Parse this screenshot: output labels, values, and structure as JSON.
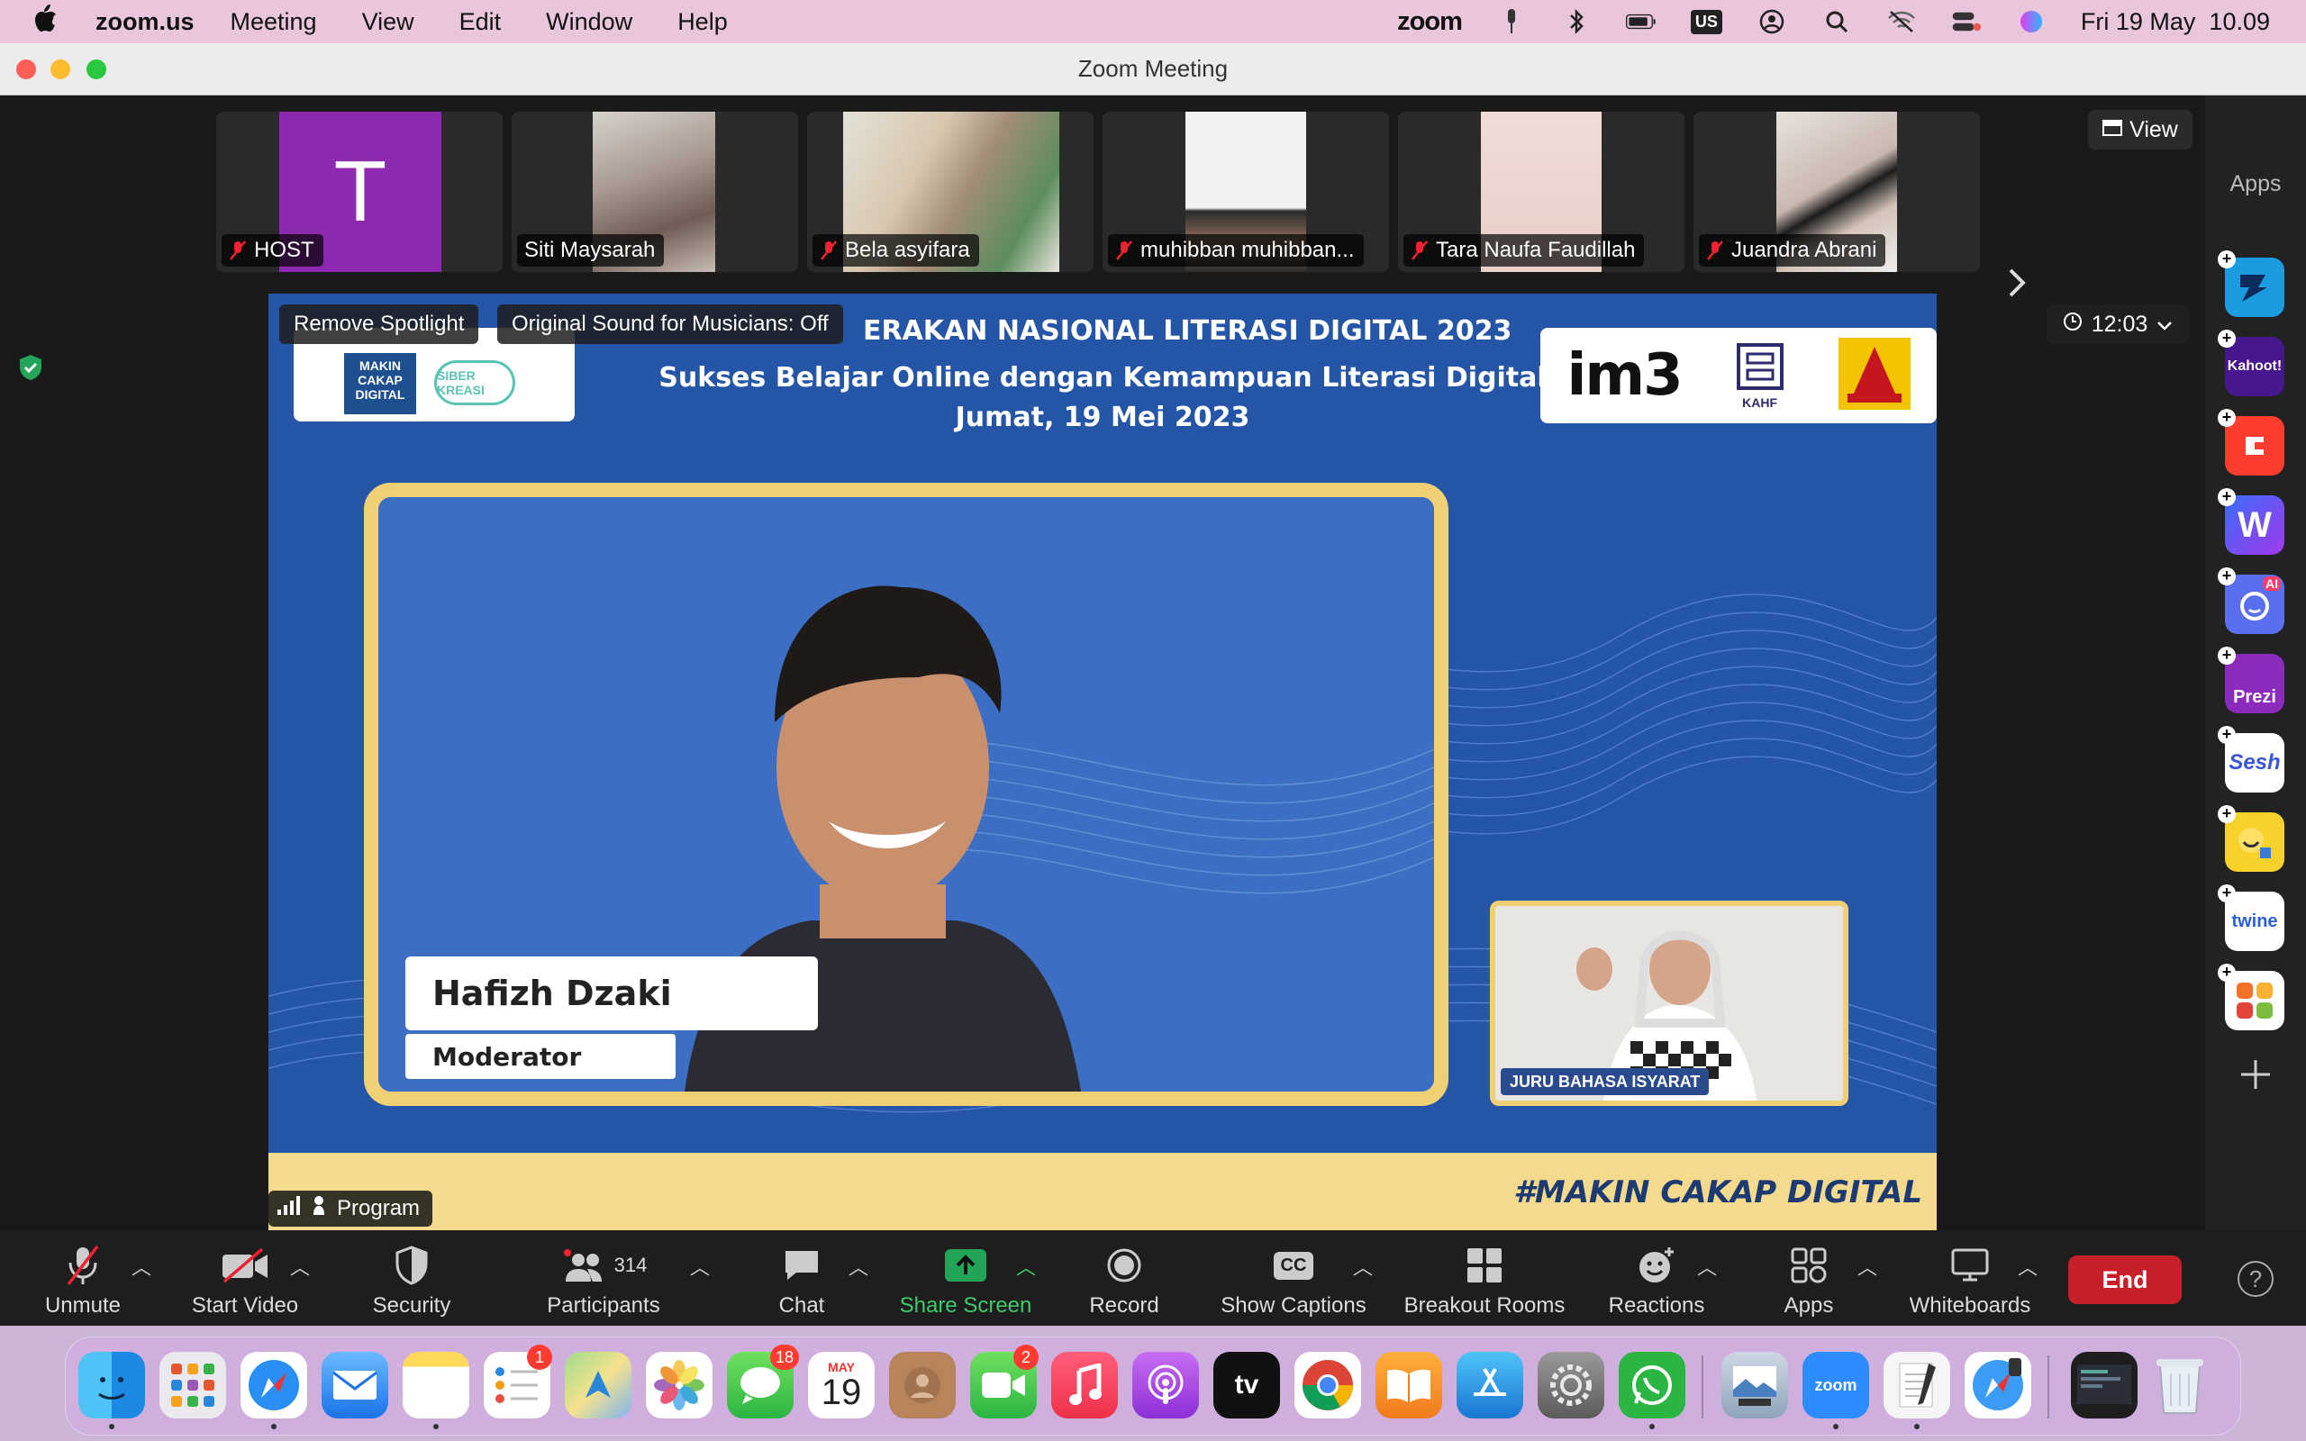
{
  "menubar": {
    "app_name": "zoom.us",
    "items": [
      "Meeting",
      "View",
      "Edit",
      "Window",
      "Help"
    ],
    "zoom_label": "zoom",
    "keyboard": "US",
    "datetime": "Fri 19 May  10.09"
  },
  "window": {
    "title": "Zoom Meeting"
  },
  "thumbnails": [
    {
      "name": "HOST",
      "initial": "T",
      "avatar_color": "#8e2ab0"
    },
    {
      "name": "Siti Maysarah"
    },
    {
      "name": "Bela asyifara"
    },
    {
      "name": "muhibban muhibban..."
    },
    {
      "name": "Tara Naufa Faudillah"
    },
    {
      "name": "Juandra Abrani"
    }
  ],
  "view_button": "View",
  "overlay": {
    "remove_spotlight": "Remove Spotlight",
    "original_sound": "Original Sound for Musicians: Off",
    "program": "Program",
    "timer": "12:03"
  },
  "slide": {
    "title1": "ERAKAN NASIONAL LITERASI DIGITAL 2023",
    "title2": "Sukses Belajar Online dengan Kemampuan Literasi Digital",
    "title3": "Jumat, 19 Mei 2023",
    "sponsor": "im3",
    "sponsor2": "KAHF",
    "speaker_name": "Hafizh Dzaki",
    "speaker_role": "Moderator",
    "interpreter_label": "JURU BAHASA ISYARAT",
    "hashtag": "#MAKIN CAKAP DIGITAL",
    "logo_left": "MAKIN CAKAP DIGITAL",
    "logo_left2": "SIBER KREASI"
  },
  "apps_panel": {
    "title": "Apps",
    "apps": [
      {
        "name": "app-1",
        "label": "",
        "color": "#1b9be0"
      },
      {
        "name": "kahoot",
        "label": "Kahoot!",
        "color": "#46178f"
      },
      {
        "name": "app-3",
        "label": "",
        "color": "#ff3d2e"
      },
      {
        "name": "wooclap",
        "label": "W",
        "color": "#5b3bf5"
      },
      {
        "name": "app-ai",
        "label": "AI",
        "color": "#5a6ff0"
      },
      {
        "name": "prezi",
        "label": "Prezi",
        "color": "#8a2bbd"
      },
      {
        "name": "sesh",
        "label": "Sesh",
        "color": "#ffffff"
      },
      {
        "name": "app-emoji",
        "label": "",
        "color": "#f7d22b"
      },
      {
        "name": "twine",
        "label": "twine",
        "color": "#ffffff"
      },
      {
        "name": "app-grid",
        "label": "",
        "color": "#ffffff"
      }
    ]
  },
  "toolbar": {
    "unmute": "Unmute",
    "start_video": "Start Video",
    "security": "Security",
    "participants": "Participants",
    "participants_count": "314",
    "chat": "Chat",
    "share_screen": "Share Screen",
    "record": "Record",
    "show_captions": "Show Captions",
    "captions_cc": "CC",
    "breakout_rooms": "Breakout Rooms",
    "reactions": "Reactions",
    "apps": "Apps",
    "whiteboards": "Whiteboards",
    "end": "End",
    "help": "?"
  },
  "dock": {
    "calendar_month": "MAY",
    "calendar_day": "19",
    "reminders_badge": "1",
    "messages_badge": "18",
    "facetime_badge": "2",
    "tv_label": "tv",
    "zoom_label": "zoom",
    "app_names": [
      "Finder",
      "Launchpad",
      "Safari",
      "Mail",
      "Notes",
      "Reminders",
      "Maps",
      "Photos",
      "Messages",
      "Calendar",
      "Contacts",
      "FaceTime",
      "Music",
      "Podcasts",
      "TV",
      "Chrome",
      "Books",
      "App Store",
      "System Settings",
      "WhatsApp",
      "Preview",
      "Zoom",
      "TextEdit",
      "Safari Tech",
      "Terminal",
      "Trash"
    ]
  }
}
